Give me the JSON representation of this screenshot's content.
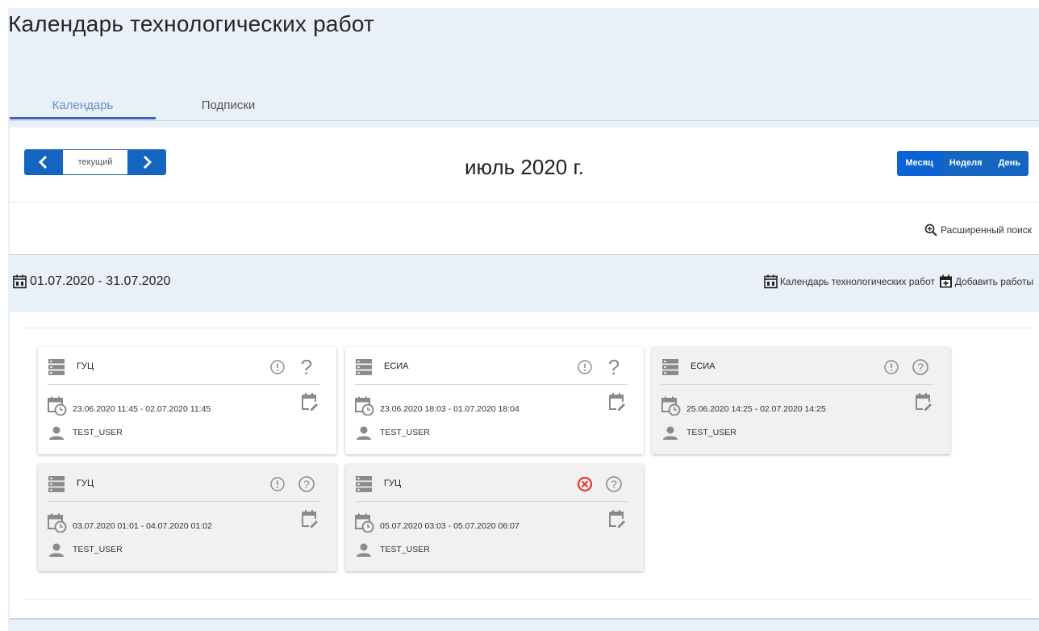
{
  "page": {
    "title": "Календарь технологических работ"
  },
  "tabs": [
    {
      "label": "Календарь",
      "active": true
    },
    {
      "label": "Подписки",
      "active": false
    }
  ],
  "toolbar": {
    "prev_icon": "chevron-left-icon",
    "current_label": "текущий",
    "next_icon": "chevron-right-icon",
    "period_title": "июль 2020 г.",
    "views": [
      {
        "label": "Месяц",
        "active": true
      },
      {
        "label": "Неделя",
        "active": false
      },
      {
        "label": "День",
        "active": false
      }
    ]
  },
  "search": {
    "advanced_label": "Расширенный поиск",
    "icon": "zoom-in-icon"
  },
  "range": {
    "label": "01.07.2020 - 31.07.2020",
    "calendar_link": "Календарь технологических работ",
    "add_link": "Добавить работы"
  },
  "cards": [
    {
      "system": "ГУЦ",
      "dates": "23.06.2020 11:45 - 02.07.2020 11:45",
      "user": "TEST_USER",
      "status": "warning",
      "help": "plain",
      "grey": false
    },
    {
      "system": "ЕСИА",
      "dates": "23.06.2020 18:03 - 01.07.2020 18:04",
      "user": "TEST_USER",
      "status": "warning",
      "help": "plain",
      "grey": false
    },
    {
      "system": "ЕСИА",
      "dates": "25.06.2020 14:25 - 02.07.2020 14:25",
      "user": "TEST_USER",
      "status": "warning",
      "help": "circle",
      "grey": true
    },
    {
      "system": "ГУЦ",
      "dates": "03.07.2020 01:01 - 04.07.2020 01:02",
      "user": "TEST_USER",
      "status": "warning",
      "help": "circle",
      "grey": true
    },
    {
      "system": "ГУЦ",
      "dates": "05.07.2020 03:03 - 05.07.2020 06:07",
      "user": "TEST_USER",
      "status": "cancelled",
      "help": "circle",
      "grey": true
    }
  ],
  "colors": {
    "primary": "#1565c0",
    "error": "#e53935",
    "icon_grey": "#8a8a8a",
    "tab_active": "#3d62c0"
  }
}
